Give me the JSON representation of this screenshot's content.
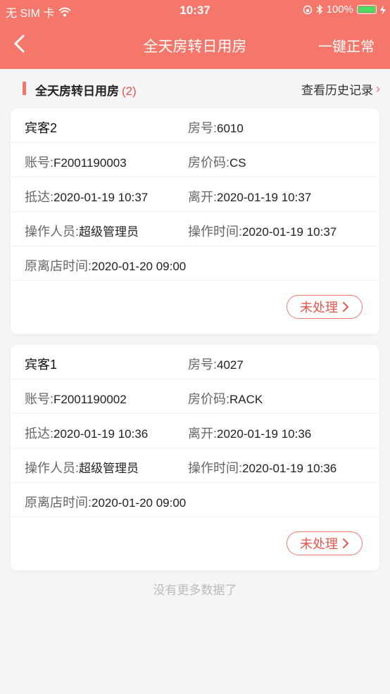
{
  "status_bar": {
    "carrier": "无 SIM 卡",
    "time": "10:37",
    "battery": "100%"
  },
  "nav": {
    "title": "全天房转日用房",
    "action": "一键正常"
  },
  "section": {
    "title": "全天房转日用房",
    "count": "(2)",
    "history": "查看历史记录"
  },
  "cards": [
    {
      "guest": "宾客2",
      "room_label": "房号:",
      "room": "6010",
      "account_label": "账号:",
      "account": "F2001190003",
      "rate_label": "房价码:",
      "rate": "CS",
      "arrive_label": "抵达:",
      "arrive": "2020-01-19 10:37",
      "depart_label": "离开:",
      "depart": "2020-01-19 10:37",
      "operator_label": "操作人员:",
      "operator": "超级管理员",
      "optime_label": "操作时间:",
      "optime": "2020-01-19 10:37",
      "orig_label": "原离店时间:",
      "orig": "2020-01-20 09:00",
      "status": "未处理"
    },
    {
      "guest": "宾客1",
      "room_label": "房号:",
      "room": "4027",
      "account_label": "账号:",
      "account": "F2001190002",
      "rate_label": "房价码:",
      "rate": "RACK",
      "arrive_label": "抵达:",
      "arrive": "2020-01-19 10:36",
      "depart_label": "离开:",
      "depart": "2020-01-19 10:36",
      "operator_label": "操作人员:",
      "operator": "超级管理员",
      "optime_label": "操作时间:",
      "optime": "2020-01-19 10:36",
      "orig_label": "原离店时间:",
      "orig": "2020-01-20 09:00",
      "status": "未处理"
    }
  ],
  "no_more": "没有更多数据了",
  "colors": {
    "accent": "#f5766a",
    "status_text": "#e8554a"
  }
}
